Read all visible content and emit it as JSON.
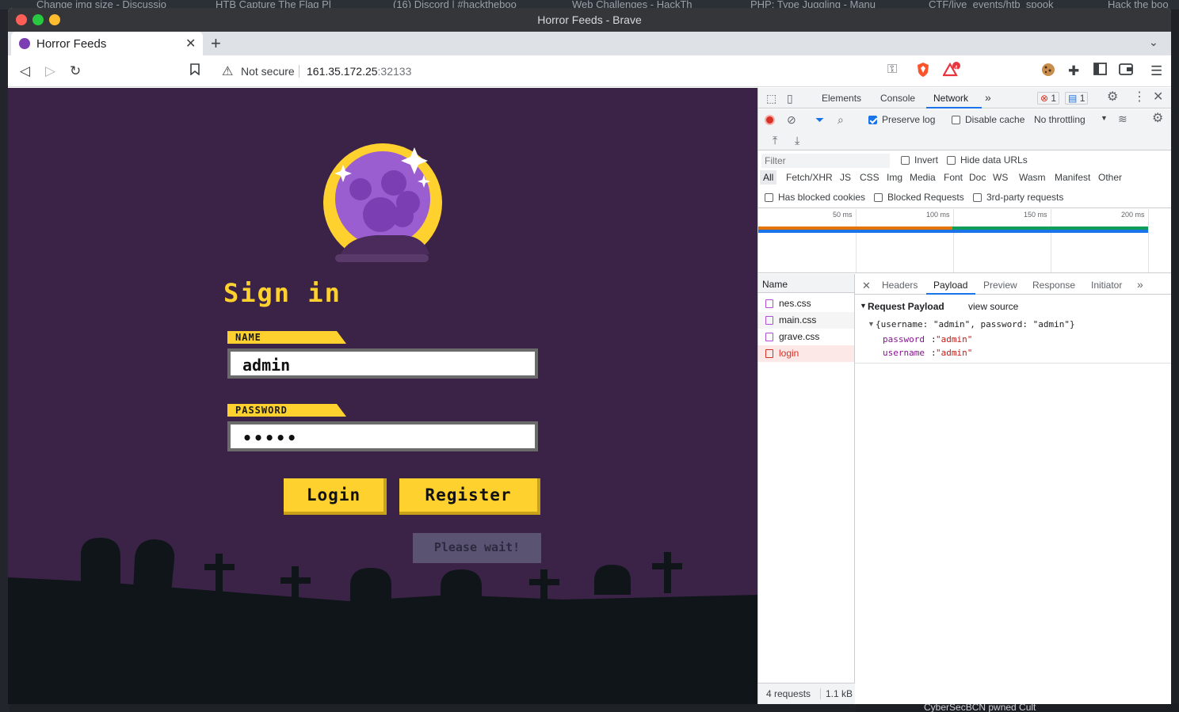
{
  "background_tabs": [
    "Change img size - Discussio",
    "HTB Capture The Flag Pl",
    "(16) Discord | #hacktheboo",
    "Web Challenges - HackTh",
    "PHP: Type Juggling - Manu",
    "CTF/live_events/htb_spook",
    "Hack the boo"
  ],
  "background_bottom_text": "CyberSecBCN pwned Cult",
  "window": {
    "title": "Horror Feeds - Brave"
  },
  "tab": {
    "title": "Horror Feeds",
    "close": "✕",
    "new": "+",
    "menu": "⌄"
  },
  "address_bar": {
    "security_label": "Not secure",
    "url_host": "161.35.172.25",
    "url_port": ":32133",
    "brave_badge": "4"
  },
  "page": {
    "heading": "Sign in",
    "name_label": "NAME",
    "name_value": "admin",
    "password_label": "PASSWORD",
    "password_value": "•••••",
    "login_button": "Login",
    "register_button": "Register",
    "status_message": "Please wait!"
  },
  "devtools": {
    "tabs": [
      "Elements",
      "Console",
      "Network"
    ],
    "active_tab": "Network",
    "error_count": "1",
    "message_count": "1",
    "preserve_log": "Preserve log",
    "preserve_log_checked": true,
    "disable_cache": "Disable cache",
    "throttling": "No throttling",
    "filter_placeholder": "Filter",
    "invert": "Invert",
    "hide_data_urls": "Hide data URLs",
    "type_filters": [
      "All",
      "Fetch/XHR",
      "JS",
      "CSS",
      "Img",
      "Media",
      "Font",
      "Doc",
      "WS",
      "Wasm",
      "Manifest",
      "Other"
    ],
    "has_blocked_cookies": "Has blocked cookies",
    "blocked_requests": "Blocked Requests",
    "third_party": "3rd-party requests",
    "timeline_ticks": [
      "50 ms",
      "100 ms",
      "150 ms",
      "200 ms"
    ],
    "name_header": "Name",
    "requests": [
      {
        "name": "nes.css",
        "selected": false
      },
      {
        "name": "main.css",
        "selected": false
      },
      {
        "name": "grave.css",
        "selected": false
      },
      {
        "name": "login",
        "selected": true
      }
    ],
    "detail_tabs": [
      "Headers",
      "Payload",
      "Preview",
      "Response",
      "Initiator"
    ],
    "active_detail_tab": "Payload",
    "payload_title": "Request Payload",
    "view_source": "view source",
    "payload_summary": "{username: \"admin\", password: \"admin\"}",
    "payload_fields": [
      {
        "key": "password",
        "value": "\"admin\""
      },
      {
        "key": "username",
        "value": "\"admin\""
      }
    ],
    "status_requests": "4 requests",
    "status_size": "1.1 kB"
  },
  "colors": {
    "page_bg": "#3b2347",
    "accent_yellow": "#ffd12e",
    "network_blue": "#1a73e8"
  }
}
